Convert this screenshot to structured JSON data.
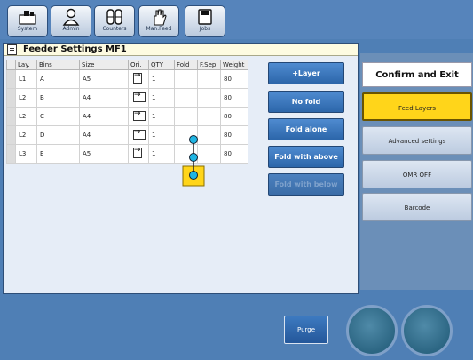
{
  "nav": {
    "items": [
      {
        "label": "System"
      },
      {
        "label": "Admin"
      },
      {
        "label": "Counters"
      },
      {
        "label": "Man.Feed"
      },
      {
        "label": "Jobs"
      }
    ]
  },
  "panel": {
    "title": "Feeder Settings MF1",
    "columns": [
      "Lay.",
      "Bins",
      "Size",
      "Ori.",
      "QTY",
      "Fold",
      "F.Sep",
      "Weight"
    ],
    "rows": [
      {
        "layer": "L1",
        "bin": "A",
        "size": "A5",
        "orientation": "portrait",
        "qty": "1",
        "weight": "80"
      },
      {
        "layer": "L2",
        "bin": "B",
        "size": "A4",
        "orientation": "landscape",
        "qty": "1",
        "weight": "80"
      },
      {
        "layer": "L2",
        "bin": "C",
        "size": "A4",
        "orientation": "landscape",
        "qty": "1",
        "weight": "80"
      },
      {
        "layer": "L2",
        "bin": "D",
        "size": "A4",
        "orientation": "landscape",
        "qty": "1",
        "weight": "80"
      },
      {
        "layer": "L3",
        "bin": "E",
        "size": "A5",
        "orientation": "portrait",
        "qty": "1",
        "weight": "80"
      }
    ]
  },
  "actions": {
    "add_layer": "+Layer",
    "no_fold": "No fold",
    "fold_alone": "Fold alone",
    "fold_with_above": "Fold with above",
    "fold_with_below": "Fold with below"
  },
  "right": {
    "confirm": "Confirm and Exit",
    "feed_layers": "Feed Layers",
    "advanced": "Advanced settings",
    "omr": "OMR OFF",
    "barcode": "Barcode"
  },
  "bottom": {
    "purge": "Purge"
  },
  "colors": {
    "background": "#4f7fb5",
    "active_button": "#ffd51a",
    "fold_marker": "#1fb5e3",
    "fold_highlight": "#ffd51a"
  }
}
